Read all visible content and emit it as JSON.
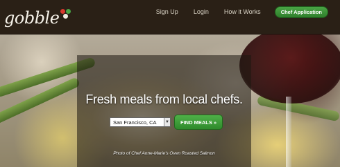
{
  "brand": {
    "name": "gobble",
    "dot_colors": [
      "#d83a2e",
      "#4aa545",
      "#f2eee4"
    ]
  },
  "nav": {
    "items": [
      {
        "label": "Sign Up"
      },
      {
        "label": "Login"
      },
      {
        "label": "How it Works"
      }
    ],
    "cta_label": "Chef Application",
    "cta_color": "#3a9a37"
  },
  "hero": {
    "headline": "Fresh meals from local chefs.",
    "location_value": "San Francisco, CA",
    "find_button_label": "FIND MEALS »",
    "caption": "Photo of Chef Anne-Marie's Oven Roasted Salmon"
  }
}
